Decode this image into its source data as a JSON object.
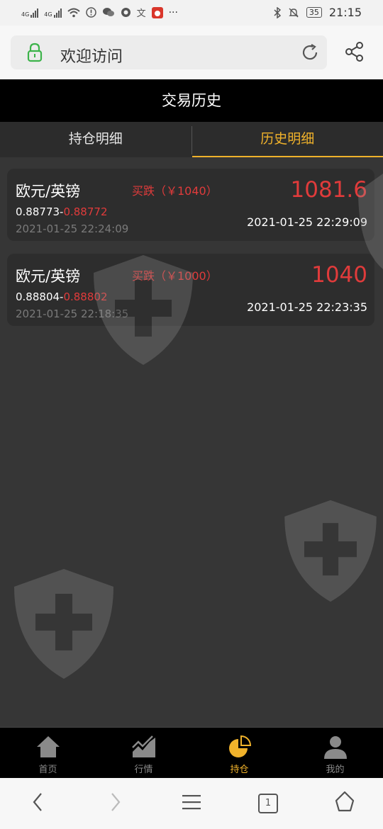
{
  "status_bar": {
    "net1": "4G",
    "net2": "4G",
    "battery": "35",
    "time": "21:15",
    "more": "···"
  },
  "url_bar": {
    "title": "欢迎访问"
  },
  "header": {
    "title": "交易历史"
  },
  "tabs": [
    {
      "label": "持仓明细",
      "active": false
    },
    {
      "label": "历史明细",
      "active": true
    }
  ],
  "records": [
    {
      "pair": "欧元/英镑",
      "direction": "买跌（￥1040）",
      "open_price": "0.88773",
      "close_price": "0.88772",
      "open_time": "2021-01-25 22:24:09",
      "amount": "1081.6",
      "close_time": "2021-01-25 22:29:09"
    },
    {
      "pair": "欧元/英镑",
      "direction": "买跌（￥1000）",
      "open_price": "0.88804",
      "close_price": "0.88802",
      "open_time": "2021-01-25 22:18:35",
      "amount": "1040",
      "close_time": "2021-01-25 22:23:35"
    }
  ],
  "tab_bar": [
    {
      "label": "首页",
      "icon": "home-icon"
    },
    {
      "label": "行情",
      "icon": "market-chart-icon"
    },
    {
      "label": "持仓",
      "icon": "pie-icon",
      "active": true
    },
    {
      "label": "我的",
      "icon": "user-icon"
    }
  ],
  "browser_nav": {
    "tab_count": "1"
  },
  "colors": {
    "accent": "#f0b22b",
    "loss": "#e03b3b",
    "background": "#363636"
  }
}
